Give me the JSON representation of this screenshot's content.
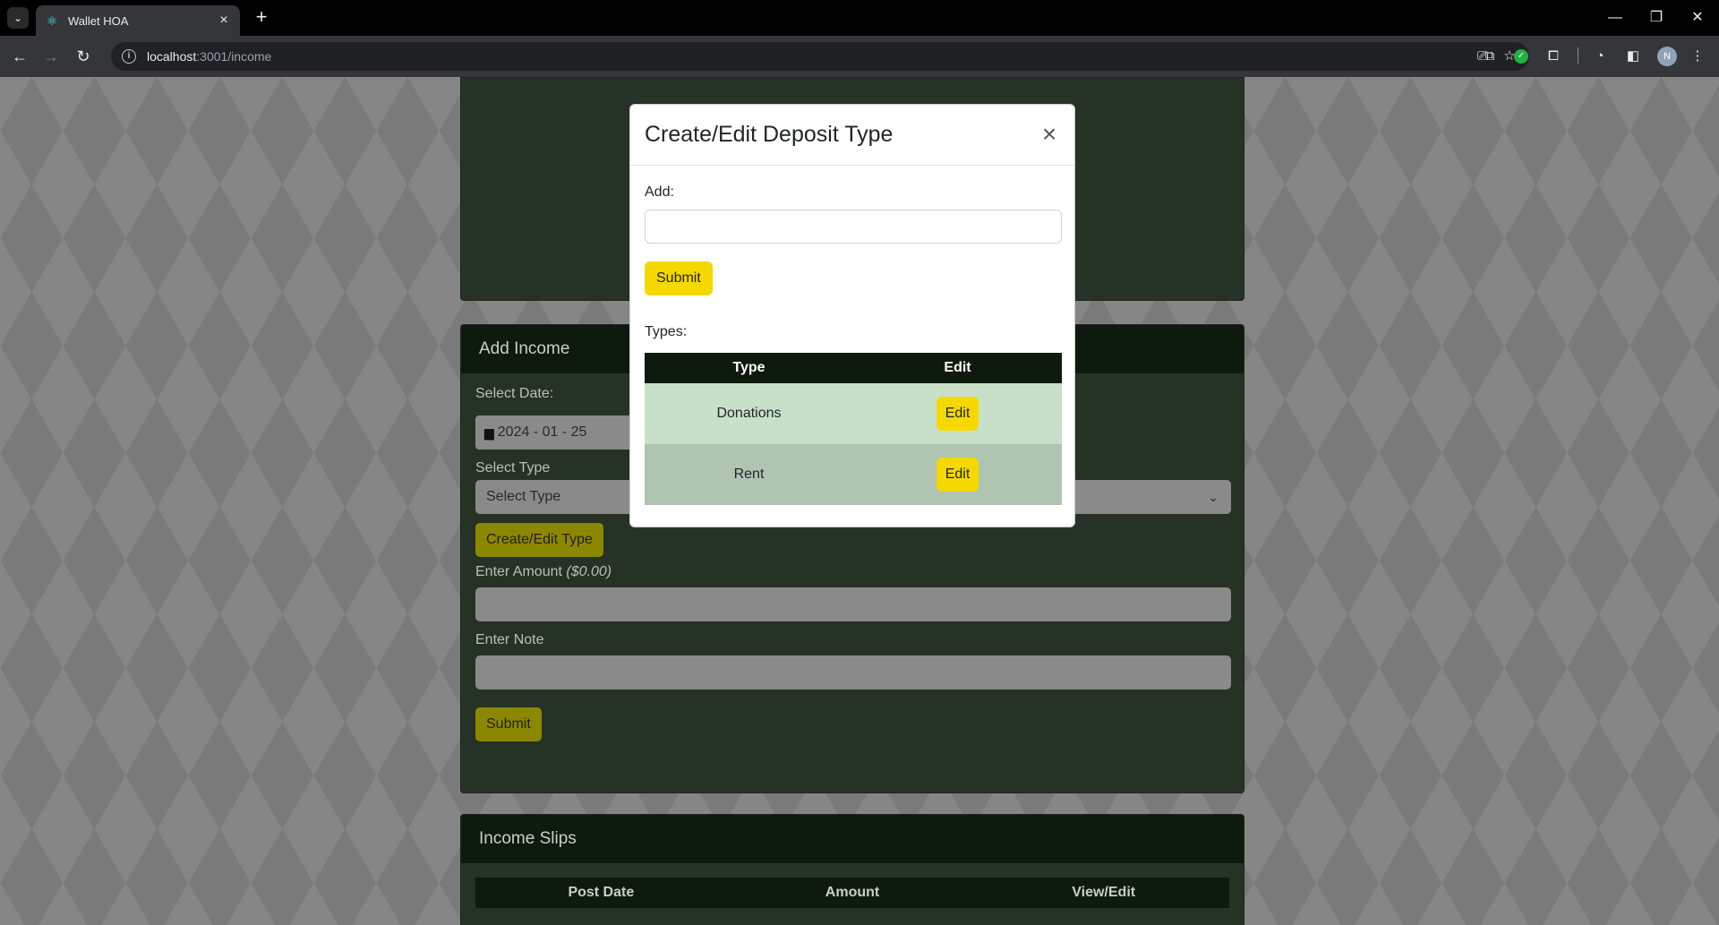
{
  "browser": {
    "tab_title": "Wallet HOA",
    "url_host": "localhost",
    "url_path": ":3001/income",
    "avatar_initial": "N"
  },
  "page": {
    "add_income": {
      "header": "Add Income",
      "select_date_label": "Select Date:",
      "date_value": "2024 - 01 - 25",
      "select_type_label": "Select Type",
      "select_type_value": "Select Type",
      "create_edit_type_button": "Create/Edit Type",
      "amount_label": "Enter Amount",
      "amount_hint": "($0.00)",
      "note_label": "Enter Note",
      "submit_button": "Submit"
    },
    "income_slips": {
      "header": "Income Slips",
      "columns": [
        "Post Date",
        "Amount",
        "View/Edit"
      ]
    }
  },
  "modal": {
    "title": "Create/Edit Deposit Type",
    "add_label": "Add:",
    "add_input_value": "",
    "submit_button": "Submit",
    "types_label": "Types:",
    "columns": [
      "Type",
      "Edit"
    ],
    "rows": [
      {
        "type": "Donations",
        "edit": "Edit"
      },
      {
        "type": "Rent",
        "edit": "Edit"
      }
    ]
  },
  "colors": {
    "accent_yellow": "#f5d800",
    "header_dark_green": "#0f1a0f",
    "card_green": "#263226"
  }
}
